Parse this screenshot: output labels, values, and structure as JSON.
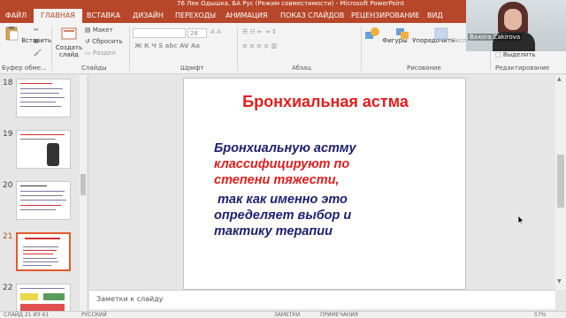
{
  "window": {
    "title": "76 Лек Одышка. БА Рус (Режим совместимости) - Microsoft PowerPoint"
  },
  "tabs": [
    {
      "label": "ФАЙЛ"
    },
    {
      "label": "ГЛАВНАЯ"
    },
    {
      "label": "ВСТАВКА"
    },
    {
      "label": "ДИЗАЙН"
    },
    {
      "label": "ПЕРЕХОДЫ"
    },
    {
      "label": "АНИМАЦИЯ"
    },
    {
      "label": "ПОКАЗ СЛАЙДОВ"
    },
    {
      "label": "РЕЦЕНЗИРОВАНИЕ"
    },
    {
      "label": "ВИД"
    }
  ],
  "ribbon": {
    "clipboard": {
      "paste": "Вставить",
      "group": "Буфер обме..."
    },
    "slides": {
      "new_slide": "Создать слайд",
      "layout": "Макет",
      "reset": "Сбросить",
      "section": "Раздел",
      "group": "Слайды"
    },
    "font": {
      "size": "28",
      "group": "Шрифт"
    },
    "paragraph": {
      "group": "Абзац"
    },
    "drawing": {
      "shapes": "Фигуры",
      "arrange": "Упорядочить",
      "styles": "Экспресс-стили",
      "group": "Рисование"
    },
    "editing": {
      "select": "Выделить",
      "group": "Редактирование"
    }
  },
  "webcam": {
    "name": "Baxora Zakirova"
  },
  "thumbnails": [
    {
      "number": "18"
    },
    {
      "number": "19"
    },
    {
      "number": "20"
    },
    {
      "number": "21"
    },
    {
      "number": "22"
    }
  ],
  "slide": {
    "title": "Бронхиальная астма",
    "line1": "Бронхиальную астму",
    "line2": "классифицируют по",
    "line3": "степени тяжести,",
    "line4": "так как именно это",
    "line5": "определяет выбор и",
    "line6": "тактику терапии"
  },
  "notes": {
    "placeholder": "Заметки к слайду"
  },
  "status": {
    "slide": "СЛАЙД 21 ИЗ 61",
    "language": "РУССКИЙ",
    "notes": "ЗАМЕТКИ",
    "comments": "ПРИМЕЧАНИЯ",
    "zoom": "57%"
  },
  "colors": {
    "accent": "#b7472a",
    "slide_title": "#e01e1e",
    "slide_text": "#1c1e6e"
  }
}
